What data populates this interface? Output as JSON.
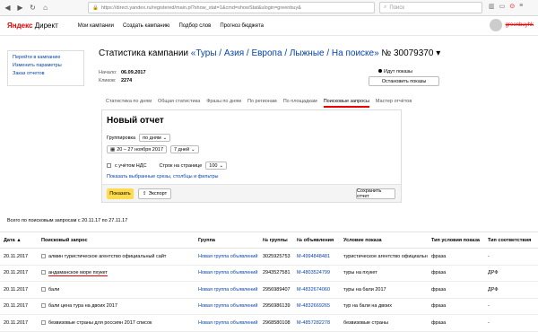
{
  "browser": {
    "url_host": "https://direct.yandex.ru/registered/main.pl?show_stat=1&cmd=showStat&ulogin=greenbuy&",
    "search_placeholder": "Поиск"
  },
  "header": {
    "logo_ya": "Яндекс",
    "logo_dir": " Директ",
    "nav": [
      "Мои кампании",
      "Создать кампанию",
      "Подбор слов",
      "Прогноз бюджета"
    ],
    "username": "greenbuyhk"
  },
  "sidebar": {
    "links": [
      "Перейти в кампанию",
      "Изменить параметры",
      "Заказ отчетов"
    ]
  },
  "campaign": {
    "title_prefix": "Статистика кампании ",
    "title_link": "«Туры / Азия / Европа / Лыжные / На поиске»",
    "title_suffix": " № 30079370 ▾",
    "start_label": "Начало:",
    "start_value": "06.09.2017",
    "clicks_label": "Кликов:",
    "clicks_value": "2274",
    "shows_status": "Идут показы",
    "stop_button": "Остановить показы"
  },
  "tabs": [
    "Статистика по дням",
    "Общая статистика",
    "Фразы по дням",
    "По регионам",
    "По площадкам",
    "Поисковые запросы",
    "Мастер отчётов"
  ],
  "active_tab": 5,
  "report": {
    "title": "Новый отчет",
    "group_label": "Группировка",
    "group_value": "по дням",
    "date_range": "20 – 27 ноября 2017",
    "days_value": "7 дней",
    "vat_label": "с учётом НДС",
    "rows_label": "Строк на странице",
    "rows_value": "100",
    "filters_link": "Показать выбранные срезы, столбцы и фильтры",
    "show_button": "Показать",
    "export_button": "Экспорт",
    "save_button": "Сохранить отчет"
  },
  "summary": "Всего по поисковым запросам с 20.11.17 по 27.11.17",
  "table": {
    "headers": [
      "Дата ▲",
      "Поисковый запрос",
      "Группа",
      "№ группы",
      "№ объявления",
      "Условие показа",
      "Тип условия показа",
      "Тип соответствия"
    ],
    "rows": [
      [
        "20.11.2017",
        "алмин туристическое агентство официальный сайт",
        "Новая группа объявлений",
        "3025925753",
        "М-4994848481",
        "туристическое агентство официальный",
        "фраза",
        "-"
      ],
      [
        "20.11.2017",
        "андаманское море пхукет",
        "Новая группа объявлений",
        "2943527581",
        "М-4803524799",
        "туры на пхукет",
        "фраза",
        "ДРФ"
      ],
      [
        "20.11.2017",
        "бали",
        "Новая группа объявлений",
        "2956989407",
        "М-4832674060",
        "туры на бали 2017",
        "фраза",
        "ДРФ"
      ],
      [
        "20.11.2017",
        "бали цена тура на двоих 2017",
        "Новая группа объявлений",
        "2956986139",
        "М-4832669265",
        "тур на бали на двоих",
        "фраза",
        "-"
      ],
      [
        "20.11.2017",
        "безвизовые страны для россиян 2017 список",
        "Новая группа объявлений",
        "2968580108",
        "М-4857282278",
        "безвизовые страны",
        "фраза",
        "-"
      ]
    ]
  }
}
